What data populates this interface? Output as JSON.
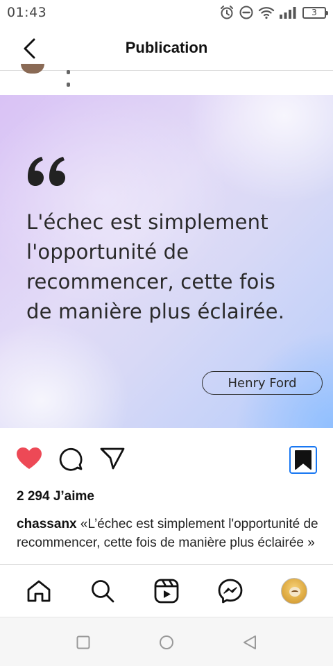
{
  "status_bar": {
    "time": "01:43",
    "battery_level": "3",
    "icons": [
      "alarm-icon",
      "do-not-disturb-icon",
      "wifi-icon",
      "signal-icon",
      "battery-icon"
    ]
  },
  "header": {
    "title": "Publication",
    "back_icon": "chevron-left-icon"
  },
  "post": {
    "image": {
      "quote_mark": "66",
      "quote_line_1": "L'échec est simplement",
      "quote_line_2": "l'opportunité de",
      "quote_line_3": "recommencer, cette fois",
      "quote_line_4": "de manière plus éclairée.",
      "author": "Henry Ford"
    },
    "actions": {
      "like_icon": "heart-icon",
      "comment_icon": "comment-icon",
      "share_icon": "send-icon",
      "save_icon": "bookmark-icon",
      "liked": true,
      "saved": true
    },
    "likes_text": "2 294 J’aime",
    "caption_user": "chassanx",
    "caption_text": "«L’échec est simplement l'opportunité de recommencer, cette fois de manière plus éclairée »"
  },
  "bottom_nav": {
    "items": [
      "home-icon",
      "search-icon",
      "reels-icon",
      "messenger-icon",
      "profile-avatar"
    ]
  },
  "system_nav": {
    "items": [
      "recents-square-icon",
      "home-circle-icon",
      "back-triangle-icon"
    ]
  },
  "colors": {
    "like_red": "#ed4956",
    "save_border": "#1877f2",
    "text": "#111111"
  }
}
